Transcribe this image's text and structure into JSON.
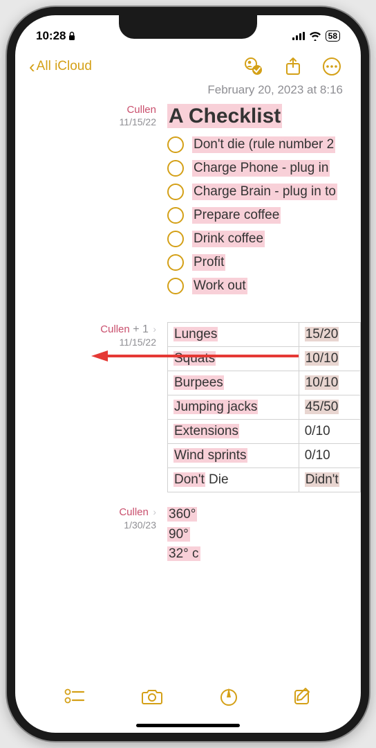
{
  "status": {
    "time": "10:28",
    "battery": "58"
  },
  "nav": {
    "back_label": "All iCloud"
  },
  "timestamp": "February 20, 2023 at 8:16",
  "section1": {
    "author": "Cullen",
    "date": "11/15/22",
    "title": "A Checklist",
    "items": [
      "Don't die (rule number 2",
      "Charge Phone - plug in",
      "Charge Brain - plug in to",
      "Prepare coffee",
      "Drink coffee",
      "Profit",
      "Work out"
    ]
  },
  "section2": {
    "author": "Cullen",
    "plus": "+ 1",
    "date": "11/15/22",
    "rows": [
      {
        "name": "Lunges",
        "name_hl": true,
        "val": "15/20",
        "val_hl": true
      },
      {
        "name": "Squats",
        "name_hl": true,
        "val": "10/10",
        "val_hl": true
      },
      {
        "name": "Burpees",
        "name_hl": true,
        "val": "10/10",
        "val_hl": true
      },
      {
        "name": "Jumping jacks",
        "name_hl": true,
        "val": "45/50",
        "val_hl": true
      },
      {
        "name": "Extensions",
        "name_hl": true,
        "val": "0/10",
        "val_hl": false
      },
      {
        "name": "Wind sprints",
        "name_hl": true,
        "val": "0/10",
        "val_hl": false
      },
      {
        "name": "Don't Die",
        "name_hl": "partial",
        "partial": "Don't",
        "rest": " Die",
        "val": "Didn't",
        "val_hl": true
      }
    ]
  },
  "section3": {
    "author": "Cullen",
    "date": "1/30/23",
    "lines": [
      "360°",
      "90°",
      "32° c"
    ]
  }
}
